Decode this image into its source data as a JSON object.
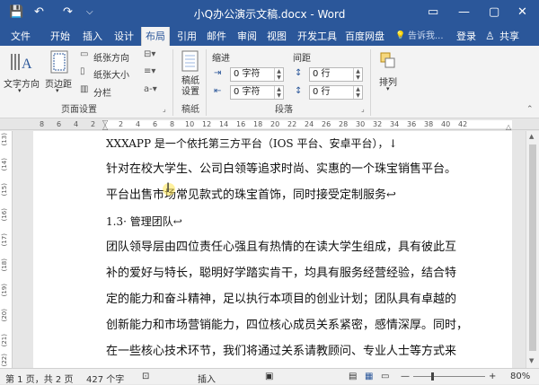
{
  "titlebar": {
    "title": "小Q办公演示文稿.docx - Word",
    "save_icon": "💾",
    "undo_icon": "↶",
    "redo_icon": "↷",
    "customize_icon": "⌵",
    "ribbon_display_icon": "▭",
    "minimize": "—",
    "restore": "▢",
    "close": "✕"
  },
  "tabs": {
    "file": "文件",
    "home": "开始",
    "insert": "插入",
    "design": "设计",
    "layout": "布局",
    "references": "引用",
    "mailings": "邮件",
    "review": "审阅",
    "view": "视图",
    "developer": "开发工具",
    "baidu": "百度网盘",
    "tellme": "告诉我...",
    "login": "登录",
    "share": "共享"
  },
  "ribbon": {
    "page_setup": {
      "text_direction": "文字方向",
      "margins": "页边距",
      "orientation": "纸张方向",
      "size": "纸张大小",
      "columns": "分栏",
      "group_label": "页面设置"
    },
    "draft": {
      "draft_label": "稿纸\n设置",
      "group_label": "稿纸"
    },
    "paragraph": {
      "indent_header": "缩进",
      "spacing_header": "间距",
      "indent_left_value": "0 字符",
      "indent_right_value": "0 字符",
      "spacing_before_value": "0 行",
      "spacing_after_value": "0 行",
      "group_label": "段落"
    },
    "arrange": {
      "arrange_label": "排列"
    }
  },
  "ruler": {
    "numbers": [
      "8",
      "6",
      "4",
      "2",
      "2",
      "4",
      "6",
      "8",
      "10",
      "12",
      "14",
      "16",
      "18",
      "20",
      "22",
      "24",
      "26",
      "28",
      "30",
      "32",
      "34",
      "36",
      "38",
      "40",
      "42"
    ]
  },
  "vruler": {
    "numbers": [
      "(13)",
      "(14)",
      "(15)",
      "(16)",
      "(17)",
      "(18)",
      "(19)",
      "(20)",
      "(21)",
      "(22)"
    ]
  },
  "document": {
    "lines": [
      "XXXAPP 是一个依托第三方平台（IOS 平台、安卓平台），↓",
      "针对在校大学生、公司白领等追求时尚、实惠的一个珠宝销售平台。",
      "平台出售市场常见款式的珠宝首饰，同时接受定制服务↩",
      "1.3· 管理团队↩",
      "团队领导层由四位责任心强且有热情的在读大学生组成，具有彼此互",
      "补的爱好与特长，聪明好学踏实肯干，均具有服务经营经验，结合特",
      "定的能力和奋斗精神，足以执行本项目的创业计划；团队具有卓越的",
      "创新能力和市场营销能力，四位核心成员关系紧密，感情深厚。同时，",
      "在一些核心技术环节，我们将通过关系请教顾问、专业人士等方式来"
    ]
  },
  "statusbar": {
    "page": "第 1 页，共 2 页",
    "words": "427 个字",
    "lang_icon": "⊡",
    "mode": "插入",
    "zoom_out": "—",
    "zoom_in": "+",
    "zoom": "80%"
  }
}
